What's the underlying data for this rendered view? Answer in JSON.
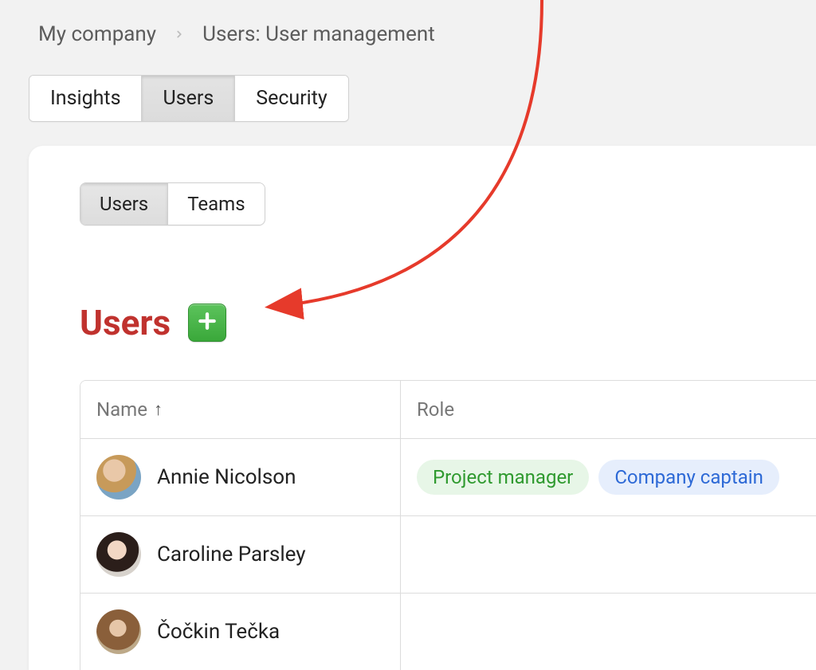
{
  "breadcrumb": {
    "root": "My company",
    "page": "Users: User management"
  },
  "main_tabs": {
    "insights": "Insights",
    "users": "Users",
    "security": "Security"
  },
  "sub_tabs": {
    "users": "Users",
    "teams": "Teams"
  },
  "section": {
    "title": "Users"
  },
  "table": {
    "columns": {
      "name": "Name",
      "role": "Role"
    },
    "rows": [
      {
        "name": "Annie Nicolson",
        "roles": [
          "Project manager",
          "Company captain"
        ]
      },
      {
        "name": "Caroline Parsley",
        "roles": []
      },
      {
        "name": "Čočkin Tečka",
        "roles": []
      }
    ]
  },
  "role_styles": {
    "Project manager": "pill-green",
    "Company captain": "pill-blue"
  }
}
